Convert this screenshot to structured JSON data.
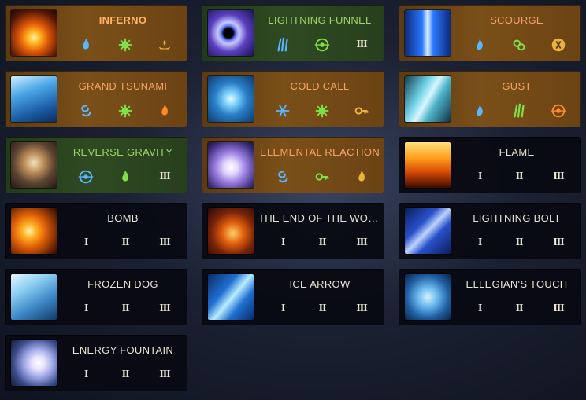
{
  "cards": [
    {
      "name": "INFERNO",
      "style": "orange",
      "highlight": true,
      "art": "fire-column",
      "slots": [
        {
          "type": "icon",
          "icon": "blue-flame-icon"
        },
        {
          "type": "icon",
          "icon": "green-burst-icon"
        },
        {
          "type": "icon",
          "icon": "golden-lamp-icon"
        }
      ]
    },
    {
      "name": "LIGHTNING FUNNEL",
      "style": "green",
      "art": "purple-vortex",
      "slots": [
        {
          "type": "icon",
          "icon": "blue-claw-icon"
        },
        {
          "type": "icon",
          "icon": "green-target-icon"
        },
        {
          "type": "roman",
          "text": "III"
        }
      ]
    },
    {
      "name": "SCOURGE",
      "style": "orange",
      "art": "blue-beam",
      "slots": [
        {
          "type": "icon",
          "icon": "blue-drop-icon"
        },
        {
          "type": "icon",
          "icon": "green-chain-icon"
        },
        {
          "type": "icon",
          "icon": "golden-rune-icon"
        }
      ]
    },
    {
      "name": "GRAND TSUNAMI",
      "style": "orange",
      "art": "wave",
      "slots": [
        {
          "type": "icon",
          "icon": "blue-swirl-icon"
        },
        {
          "type": "icon",
          "icon": "green-sun-icon"
        },
        {
          "type": "icon",
          "icon": "orange-flame-icon"
        }
      ]
    },
    {
      "name": "COLD CALL",
      "style": "orange",
      "art": "ice-sigil",
      "slots": [
        {
          "type": "icon",
          "icon": "blue-snowflake-icon"
        },
        {
          "type": "icon",
          "icon": "green-sun-icon"
        },
        {
          "type": "icon",
          "icon": "golden-key-icon"
        }
      ]
    },
    {
      "name": "GUST",
      "style": "orange",
      "art": "wind",
      "slots": [
        {
          "type": "icon",
          "icon": "blue-drop-icon"
        },
        {
          "type": "icon",
          "icon": "green-claw-icon"
        },
        {
          "type": "icon",
          "icon": "orange-target-icon"
        }
      ]
    },
    {
      "name": "REVERSE GRAVITY",
      "style": "green",
      "art": "rock-figure",
      "slots": [
        {
          "type": "icon",
          "icon": "blue-target-icon"
        },
        {
          "type": "icon",
          "icon": "green-flame-icon"
        },
        {
          "type": "roman",
          "text": "III"
        }
      ]
    },
    {
      "name": "ELEMENTAL REACTION",
      "style": "orange",
      "art": "crystal",
      "slots": [
        {
          "type": "icon",
          "icon": "blue-swirl-icon"
        },
        {
          "type": "icon",
          "icon": "green-key-icon"
        },
        {
          "type": "icon",
          "icon": "golden-flame-icon"
        }
      ]
    },
    {
      "name": "FLAME",
      "style": "dark",
      "art": "flame",
      "slots": [
        {
          "type": "roman",
          "text": "I"
        },
        {
          "type": "roman",
          "text": "II"
        },
        {
          "type": "roman",
          "text": "III"
        }
      ]
    },
    {
      "name": "BOMB",
      "style": "dark",
      "art": "fireball",
      "slots": [
        {
          "type": "roman",
          "text": "I"
        },
        {
          "type": "roman",
          "text": "II"
        },
        {
          "type": "roman",
          "text": "III"
        }
      ]
    },
    {
      "name": "THE END OF THE WOR...",
      "style": "dark",
      "art": "meteor",
      "slots": [
        {
          "type": "roman",
          "text": "I"
        },
        {
          "type": "roman",
          "text": "II"
        },
        {
          "type": "roman",
          "text": "III"
        }
      ]
    },
    {
      "name": "LIGHTNING BOLT",
      "style": "dark",
      "art": "spear",
      "slots": [
        {
          "type": "roman",
          "text": "I"
        },
        {
          "type": "roman",
          "text": "II"
        },
        {
          "type": "roman",
          "text": "III"
        }
      ]
    },
    {
      "name": "FROZEN DOG",
      "style": "dark",
      "art": "frost",
      "slots": [
        {
          "type": "roman",
          "text": "I"
        },
        {
          "type": "roman",
          "text": "II"
        },
        {
          "type": "roman",
          "text": "III"
        }
      ]
    },
    {
      "name": "ICE ARROW",
      "style": "dark",
      "art": "ice-shards",
      "slots": [
        {
          "type": "roman",
          "text": "I"
        },
        {
          "type": "roman",
          "text": "II"
        },
        {
          "type": "roman",
          "text": "III"
        }
      ]
    },
    {
      "name": "ELLEGIAN'S TOUCH",
      "style": "dark",
      "art": "orb-figure",
      "slots": [
        {
          "type": "roman",
          "text": "I"
        },
        {
          "type": "roman",
          "text": "II"
        },
        {
          "type": "roman",
          "text": "III"
        }
      ]
    },
    {
      "name": "ENERGY FOUNTAIN",
      "style": "dark",
      "art": "energy",
      "slots": [
        {
          "type": "roman",
          "text": "I"
        },
        {
          "type": "roman",
          "text": "II"
        },
        {
          "type": "roman",
          "text": "III"
        }
      ]
    }
  ]
}
